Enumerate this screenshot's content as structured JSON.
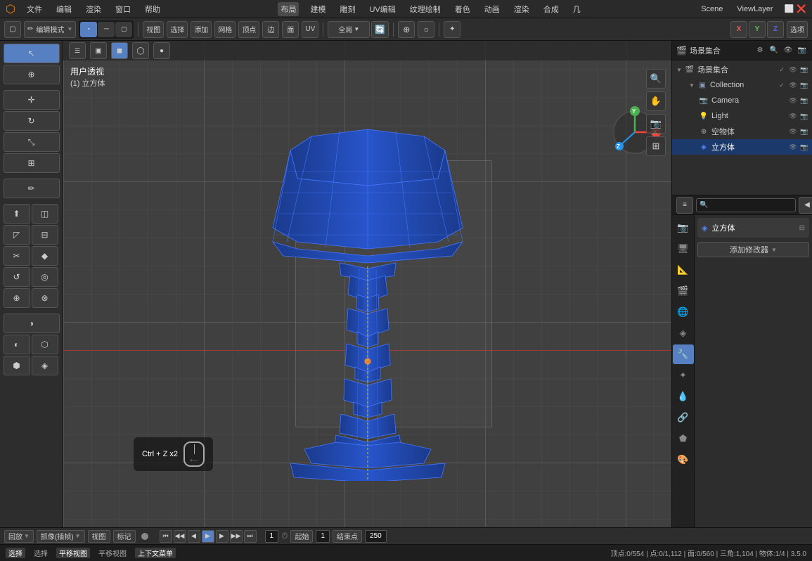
{
  "window": {
    "title": "Blender",
    "scene_name": "Scene",
    "view_layer": "ViewLayer"
  },
  "top_menu": {
    "logo": "●",
    "items": [
      "文件",
      "编辑",
      "渲染",
      "窗口",
      "帮助",
      "布局",
      "建模",
      "雕刻",
      "UV编辑",
      "纹理绘制",
      "着色",
      "动画",
      "渲染",
      "合成",
      "几"
    ]
  },
  "header_toolbar": {
    "mode_label": "编辑模式",
    "view_btn": "视图",
    "select_btn": "选择",
    "add_btn": "添加",
    "mesh_btn": "网格",
    "vertex_btn": "顶点",
    "edge_btn": "边",
    "face_btn": "面",
    "uv_btn": "UV",
    "global_btn": "全局",
    "proportional_btn": "○",
    "snap_btn": "⊕",
    "transform_btn": "✦",
    "select_mode": "选项"
  },
  "viewport": {
    "mode_label": "用户透视",
    "sub_label": "(1) 立方体",
    "hint_ctrl_z": "Ctrl + Z x2"
  },
  "outliner": {
    "title": "场景集合",
    "items": [
      {
        "id": "collection",
        "label": "Collection",
        "type": "collection",
        "indent": 1,
        "expanded": true
      },
      {
        "id": "camera",
        "label": "Camera",
        "type": "camera",
        "indent": 2
      },
      {
        "id": "light",
        "label": "Light",
        "type": "light",
        "indent": 2
      },
      {
        "id": "empty",
        "label": "空物体",
        "type": "empty",
        "indent": 2
      },
      {
        "id": "cube",
        "label": "立方体",
        "type": "mesh",
        "indent": 2,
        "active": true
      }
    ]
  },
  "properties": {
    "object_name": "立方体",
    "modifier_label": "添加修改器",
    "icons": [
      "🔧",
      "📐",
      "📊",
      "✦",
      "🎨",
      "🔗",
      "📷",
      "🌊",
      "⚙",
      "🔵",
      "✂",
      "🎯",
      "🔺"
    ]
  },
  "bottom_bar": {
    "playback": {
      "jump_start": "⏮",
      "prev_keyframe": "◀◀",
      "prev_frame": "◀",
      "play": "▶",
      "next_frame": "▶",
      "next_keyframe": "▶▶",
      "jump_end": "⏭"
    },
    "frame_current": "1",
    "frame_start_label": "起始",
    "frame_start": "1",
    "frame_end_label": "结束点",
    "frame_end": "250",
    "view_btn": "视图",
    "marker_btn": "标记",
    "playback_btn": "回放",
    "fps_selector": "抓像(插帧)"
  },
  "status_bar": {
    "select_label": "选择",
    "move_label": "平移视图",
    "context_menu_label": "上下文菜单",
    "stats": "顶点:0/554 | 点:0/1,112 | 面:0/560 | 三角:1,104 | 物体:1/4 | 3.5.0"
  }
}
